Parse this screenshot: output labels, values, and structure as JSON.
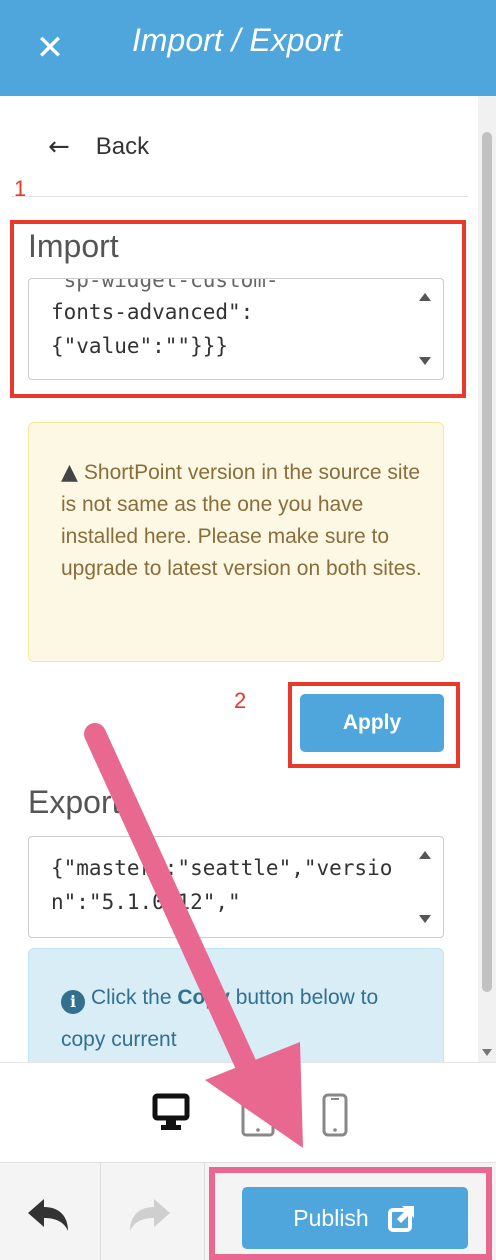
{
  "header": {
    "title": "Import / Export",
    "close_icon": "close-icon"
  },
  "nav": {
    "back_label": "Back"
  },
  "annotations": {
    "step1": "1",
    "step2": "2"
  },
  "import": {
    "label": "Import",
    "content": "fonts-advanced\":\n{\"value\":\"\"}}}"
  },
  "warning": {
    "icon": "warning-icon",
    "text": "ShortPoint version in the source site is not same as the one you have installed here. Please make sure to upgrade to latest version on both sites."
  },
  "apply": {
    "label": "Apply"
  },
  "export": {
    "label": "Export",
    "content": "{\"master\":\"seattle\",\"version\":\"5.1.0.12\",\""
  },
  "info": {
    "icon": "info-icon",
    "text_before": "Click the ",
    "text_bold": "Copy",
    "text_after": " button below to copy current"
  },
  "devices": [
    "desktop-icon",
    "tablet-icon",
    "mobile-icon"
  ],
  "footer": {
    "publish_label": "Publish"
  },
  "colors": {
    "header_bg": "#4ea6dc",
    "annotation_red": "#e8392b",
    "annotation_pink": "#e8688f"
  }
}
